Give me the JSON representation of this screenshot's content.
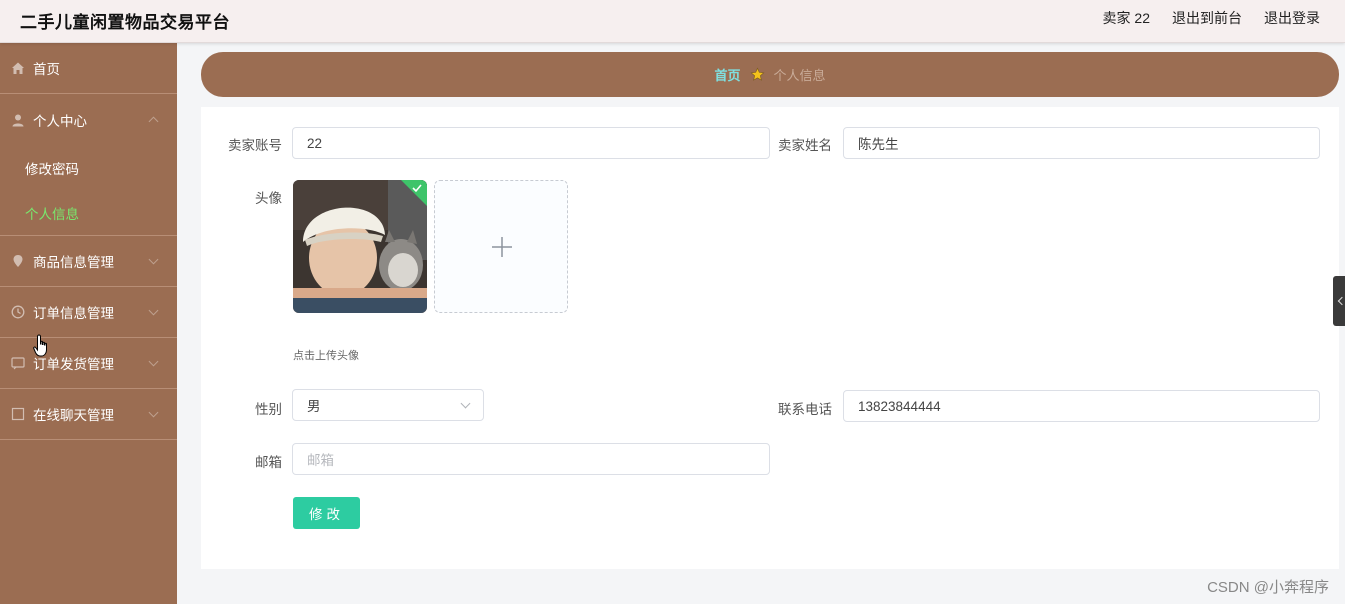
{
  "header": {
    "title": "二手儿童闲置物品交易平台",
    "user": "卖家 22",
    "front_link": "退出到前台",
    "logout_link": "退出登录"
  },
  "sidebar": {
    "items": [
      {
        "label": "首页",
        "icon": "home-icon"
      },
      {
        "label": "个人中心",
        "icon": "user-icon",
        "expanded": true,
        "children": [
          {
            "label": "修改密码"
          },
          {
            "label": "个人信息",
            "active": true
          }
        ]
      },
      {
        "label": "商品信息管理",
        "icon": "location-icon"
      },
      {
        "label": "订单信息管理",
        "icon": "clock-icon"
      },
      {
        "label": "订单发货管理",
        "icon": "message-icon"
      },
      {
        "label": "在线聊天管理",
        "icon": "chat-icon"
      }
    ]
  },
  "breadcrumb": {
    "home": "首页",
    "current": "个人信息",
    "separator_icon": "star-icon"
  },
  "form": {
    "account_label": "卖家账号",
    "account_value": "22",
    "name_label": "卖家姓名",
    "name_value": "陈先生",
    "avatar_label": "头像",
    "upload_hint": "点击上传头像",
    "gender_label": "性别",
    "gender_value": "男",
    "phone_label": "联系电话",
    "phone_value": "13823844444",
    "email_label": "邮箱",
    "email_placeholder": "邮箱",
    "submit_label": "修改"
  },
  "watermark": "CSDN @小奔程序",
  "colors": {
    "sidebar": "#9b6d52",
    "active_menu": "#79e86d",
    "primary_button": "#2dcca1",
    "breadcrumb_home": "#7fe0e0"
  }
}
